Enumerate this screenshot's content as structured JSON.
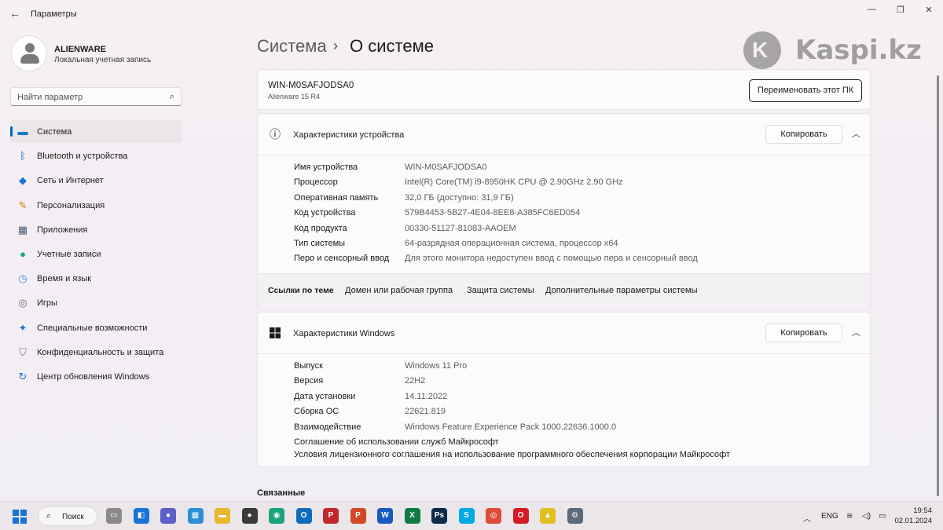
{
  "window": {
    "title": "Параметры"
  },
  "profile": {
    "name": "ALIENWARE",
    "account_type": "Локальная учетная запись"
  },
  "search": {
    "placeholder": "Найти параметр"
  },
  "nav": {
    "items": [
      {
        "label": "Система",
        "icon": "display-icon",
        "color": "#0078d4",
        "active": true
      },
      {
        "label": "Bluetooth и устройства",
        "icon": "bluetooth-icon",
        "color": "#0067c0"
      },
      {
        "label": "Сеть и Интернет",
        "icon": "wifi-icon",
        "color": "#1a73d6"
      },
      {
        "label": "Персонализация",
        "icon": "brush-icon",
        "color": "#c8781c"
      },
      {
        "label": "Приложения",
        "icon": "apps-icon",
        "color": "#4a5a6e"
      },
      {
        "label": "Учетные записи",
        "icon": "person-icon",
        "color": "#1aa37a"
      },
      {
        "label": "Время и язык",
        "icon": "globe-clock-icon",
        "color": "#2f8ed8"
      },
      {
        "label": "Игры",
        "icon": "gamepad-icon",
        "color": "#6d6d6d"
      },
      {
        "label": "Специальные возможности",
        "icon": "accessibility-icon",
        "color": "#1a73d6"
      },
      {
        "label": "Конфиденциальность и защита",
        "icon": "shield-icon",
        "color": "#6d6d6d"
      },
      {
        "label": "Центр обновления Windows",
        "icon": "update-icon",
        "color": "#1a73d6"
      }
    ]
  },
  "header": {
    "breadcrumb_parent": "Система",
    "breadcrumb_separator": "›",
    "breadcrumb_current": "О системе"
  },
  "watermark": {
    "text": "Kaspi.kz"
  },
  "pc": {
    "name": "WIN-M0SAFJODSA0",
    "model": "Alienware 15 R4",
    "rename_label": "Переименовать этот ПК"
  },
  "device_specs": {
    "title": "Характеристики устройства",
    "copy_label": "Копировать",
    "rows": [
      {
        "key": "Имя устройства",
        "value": "WIN-M0SAFJODSA0"
      },
      {
        "key": "Процессор",
        "value": "Intel(R) Core(TM) i9-8950HK CPU @ 2.90GHz   2.90 GHz"
      },
      {
        "key": "Оперативная память",
        "value": "32,0 ГБ (доступно: 31,9 ГБ)"
      },
      {
        "key": "Код устройства",
        "value": "579B4453-5B27-4E04-8EE8-A385FC6ED054"
      },
      {
        "key": "Код продукта",
        "value": "00330-51127-81083-AAOEM"
      },
      {
        "key": "Тип системы",
        "value": "64-разрядная операционная система, процессор x64"
      },
      {
        "key": "Перо и сенсорный ввод",
        "value": "Для этого монитора недоступен ввод с помощью пера и сенсорный ввод"
      }
    ],
    "links_title": "Ссылки по теме",
    "links": [
      "Домен или рабочая группа",
      "Защита системы",
      "Дополнительные параметры системы"
    ]
  },
  "windows_specs": {
    "title": "Характеристики Windows",
    "copy_label": "Копировать",
    "rows": [
      {
        "key": "Выпуск",
        "value": "Windows 11 Pro"
      },
      {
        "key": "Версия",
        "value": "22H2"
      },
      {
        "key": "Дата установки",
        "value": "14.11.2022"
      },
      {
        "key": "Сборка ОС",
        "value": "22621.819"
      },
      {
        "key": "Взаимодействие",
        "value": "Windows Feature Experience Pack 1000.22636.1000.0"
      }
    ],
    "links": [
      "Соглашение об использовании служб Майкрософт",
      "Условия лицензионного соглашения на использование программного обеспечения корпорации Майкрософт"
    ]
  },
  "related_title": "Связанные",
  "taskbar": {
    "search_label": "Поиск",
    "apps": [
      {
        "name": "file-manager-icon",
        "color": "#8a8a8a",
        "glyph": "▭"
      },
      {
        "name": "widgets-icon",
        "color": "#1a73d6",
        "glyph": "◧"
      },
      {
        "name": "teams-icon",
        "color": "#5b5fc7",
        "glyph": "●"
      },
      {
        "name": "store-icon",
        "color": "#2f8ed8",
        "glyph": "▦"
      },
      {
        "name": "explorer-icon",
        "color": "#e8b62c",
        "glyph": "▬"
      },
      {
        "name": "mouse-icon",
        "color": "#3a3a3a",
        "glyph": "●"
      },
      {
        "name": "edge-icon",
        "color": "#1aa37a",
        "glyph": "◉"
      },
      {
        "name": "outlook-icon",
        "color": "#0f6cbd",
        "glyph": "O"
      },
      {
        "name": "pdf-icon",
        "color": "#c4262e",
        "glyph": "P"
      },
      {
        "name": "powerpoint-icon",
        "color": "#d24726",
        "glyph": "P"
      },
      {
        "name": "word-icon",
        "color": "#185abd",
        "glyph": "W"
      },
      {
        "name": "excel-icon",
        "color": "#107c41",
        "glyph": "X"
      },
      {
        "name": "photoshop-icon",
        "color": "#0b2b4a",
        "glyph": "Ps"
      },
      {
        "name": "skype-icon",
        "color": "#00a8e8",
        "glyph": "S"
      },
      {
        "name": "chrome-icon",
        "color": "#dd4b39",
        "glyph": "◎"
      },
      {
        "name": "opera-icon",
        "color": "#d51b25",
        "glyph": "O"
      },
      {
        "name": "archive-icon",
        "color": "#e0c020",
        "glyph": "▲"
      },
      {
        "name": "settings-icon",
        "color": "#5c6a7a",
        "glyph": "⚙"
      }
    ],
    "language": "ENG",
    "time": "19:54",
    "date": "02.01.2024"
  }
}
